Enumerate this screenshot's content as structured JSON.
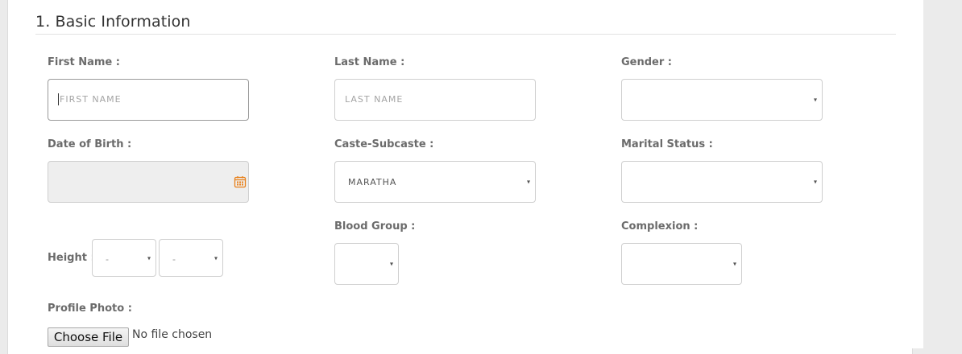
{
  "section": {
    "title": "1. Basic Information"
  },
  "fields": {
    "first_name": {
      "label": "First Name :",
      "placeholder": "FIRST NAME"
    },
    "last_name": {
      "label": "Last Name :",
      "placeholder": "LAST NAME"
    },
    "gender": {
      "label": "Gender :",
      "value": ""
    },
    "dob": {
      "label": "Date of Birth :"
    },
    "caste": {
      "label": "Caste-Subcaste :",
      "value": "MARATHA"
    },
    "marital_status": {
      "label": "Marital Status :",
      "value": ""
    },
    "height": {
      "label": "Height :",
      "feet": "-",
      "inches": "-"
    },
    "blood_group": {
      "label": "Blood Group :",
      "value": ""
    },
    "complexion": {
      "label": "Complexion :",
      "value": ""
    },
    "profile_photo": {
      "label": "Profile Photo :",
      "button": "Choose File",
      "status": "No file chosen"
    }
  },
  "icons": {
    "caret": "▾",
    "calendar": "calendar-icon"
  },
  "colors": {
    "calendar_accent": "#e8801a"
  }
}
